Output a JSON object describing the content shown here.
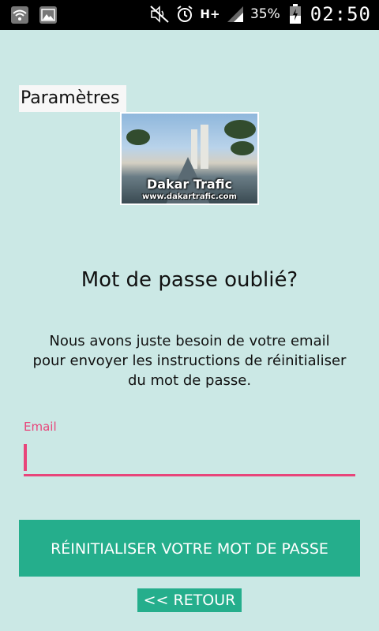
{
  "status_bar": {
    "battery": "35%",
    "clock": "02:50",
    "network": "H+",
    "icons": [
      "wifi-icon",
      "image-icon",
      "mute-icon",
      "alarm-icon",
      "network-h-plus-icon",
      "signal-icon",
      "battery-charging-icon"
    ]
  },
  "header": {
    "settings_label": "Paramètres"
  },
  "logo": {
    "title": "Dakar Trafic",
    "url": "www.dakartrafic.com"
  },
  "main": {
    "title": "Mot de passe oublié?",
    "description": "Nous avons juste besoin de votre email pour envoyer les instructions de réinitialiser du mot de passe.",
    "email_label": "Email",
    "email_value": "",
    "reset_button": "RÉINITIALISER VOTRE MOT DE PASSE",
    "back_button": "<< RETOUR"
  },
  "colors": {
    "background": "#cbe8e5",
    "accent_pink": "#e8457a",
    "button_green": "#25ae8c"
  }
}
